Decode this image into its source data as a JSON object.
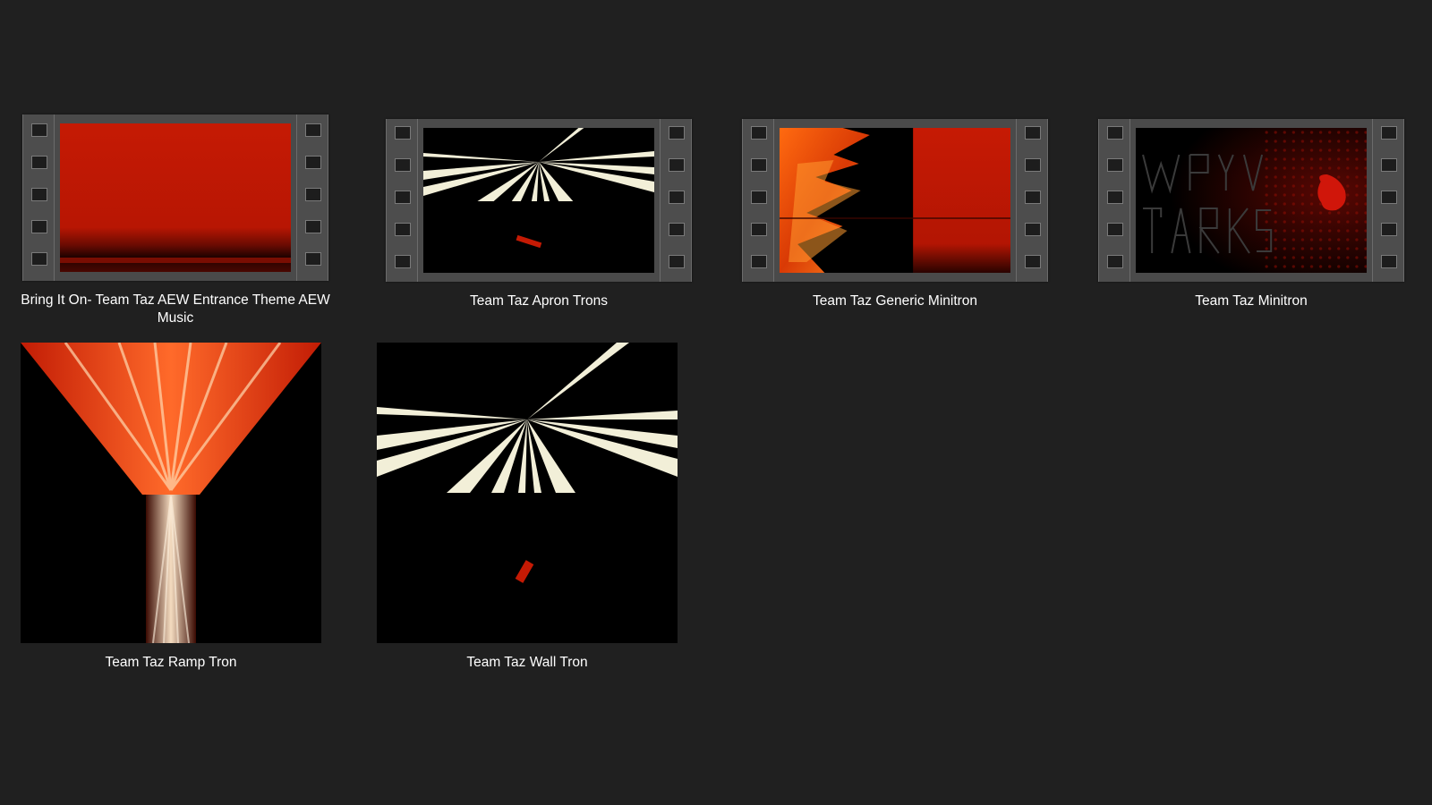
{
  "colors": {
    "background": "#202020",
    "caption_text": "#ffffff",
    "filmstrip": "#4d4d4d",
    "accent_red": "#c61e05"
  },
  "files": [
    {
      "name": "Bring It On- Team Taz AEW Entrance Theme AEW Music",
      "kind": "video",
      "icon": "video-thumbnail-icon"
    },
    {
      "name": "Team Taz Apron Trons",
      "kind": "video",
      "icon": "video-thumbnail-icon"
    },
    {
      "name": "Team Taz Generic Minitron",
      "kind": "video",
      "icon": "video-thumbnail-icon"
    },
    {
      "name": "Team Taz Minitron",
      "kind": "video",
      "icon": "video-thumbnail-icon"
    },
    {
      "name": "Team Taz Ramp Tron",
      "kind": "image",
      "icon": "image-thumbnail-icon"
    },
    {
      "name": "Team Taz Wall Tron",
      "kind": "image",
      "icon": "image-thumbnail-icon"
    }
  ]
}
